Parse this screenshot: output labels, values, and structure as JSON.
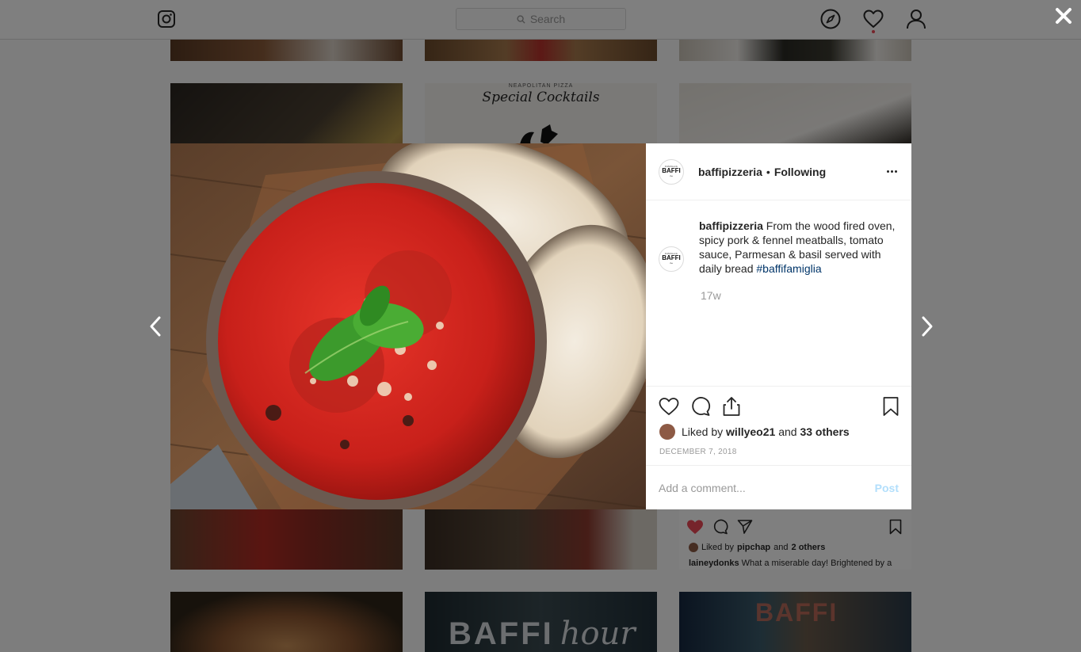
{
  "topbar": {
    "logo_icon": "instagram-camera-icon",
    "search_placeholder": "Search",
    "nav_icons": [
      "compass-explore-icon",
      "heart-activity-icon",
      "person-profile-icon"
    ],
    "notification_color": "#ed4956"
  },
  "background_grid": {
    "cocktail_tile": {
      "subtitle": "NEAPOLITAN PIZZA",
      "title": "Special Cocktails"
    },
    "feed_tile": {
      "liked_prefix": "Liked by",
      "liked_user": "pipchap",
      "liked_suffix": "and",
      "liked_others": "2 others",
      "caption_user": "laineydonks",
      "caption_text": "What a miserable day! Brightened by a"
    },
    "hour_tile": {
      "text": "BAFFI",
      "script": "hour"
    },
    "neon_tile": {
      "text": "BAFFI"
    }
  },
  "modal": {
    "close_icon": "close-x-icon",
    "prev_icon": "chevron-left-icon",
    "next_icon": "chevron-right-icon",
    "header": {
      "username": "baffipizzeria",
      "separator": "•",
      "follow_status": "Following",
      "avatar_text_small": "FAMIGLIA",
      "avatar_text_big": "BAFFI"
    },
    "caption": {
      "username": "baffipizzeria",
      "text": "From the wood fired oven, spicy pork & fennel meatballs, tomato sauce, Parmesan & basil served with daily bread",
      "hashtag": "#baffifamiglia",
      "time": "17w"
    },
    "likes": {
      "prefix": "Liked by",
      "user": "willyeo21",
      "joiner": "and",
      "others": "33 others"
    },
    "date": "December 7, 2018",
    "comment": {
      "placeholder": "Add a comment...",
      "post_label": "Post"
    },
    "colors": {
      "link": "#003569",
      "post_disabled": "#b2dffc",
      "like_red": "#ed4956"
    }
  }
}
